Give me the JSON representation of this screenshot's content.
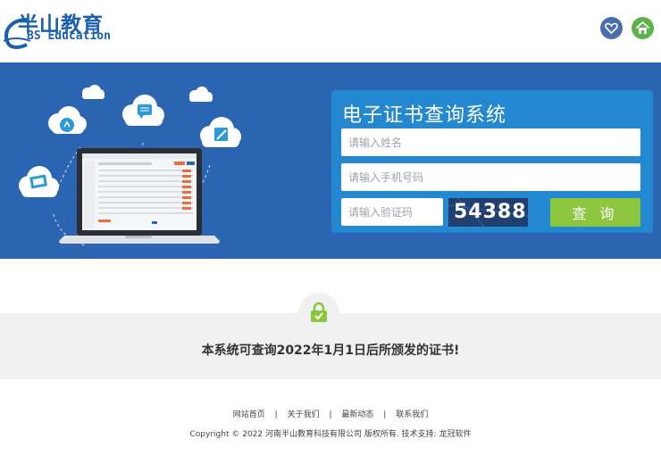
{
  "header": {
    "logo_cn": "半山教育",
    "logo_en": "BS Education",
    "icons": [
      "heart-icon",
      "home-icon"
    ]
  },
  "panel": {
    "title": "电子证书查询系统",
    "name_placeholder": "请输入姓名",
    "phone_placeholder": "请输入手机号码",
    "code_placeholder": "请输入验证码",
    "captcha": "54388",
    "query_label": "查 询"
  },
  "notice": {
    "text": "本系统可查询2022年1月1日后所颁发的证书!"
  },
  "footer": {
    "links": [
      "网站首页",
      "关于我们",
      "最新动态",
      "联系我们"
    ],
    "separator": "|",
    "copyright": "Copyright © 2022 河南半山教育科技有限公司 版权所有. 技术支持: 龙冠软件"
  },
  "colors": {
    "banner": "#2b64b0",
    "panel": "#2388cf",
    "query_button": "#8cc63f",
    "brand": "#1a5fb0"
  }
}
